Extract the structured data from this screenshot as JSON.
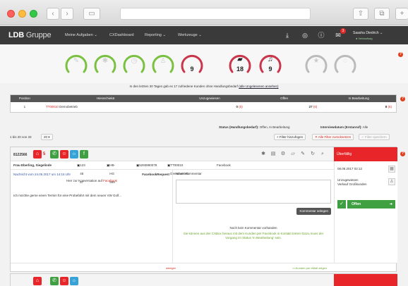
{
  "app": {
    "logo_bold": "LDB",
    "logo_rest": "Gruppe",
    "nav": [
      "Meine Aufgaben",
      "CXDashboard",
      "Reporting",
      "Werkzeuge"
    ],
    "user_name": "Saasha Diedrich",
    "user_status": "Verkaufsag",
    "notification_count": "3"
  },
  "gauges": [
    {
      "icon": "wrench-icon",
      "value": "",
      "color": "#7ac142"
    },
    {
      "icon": "star-icon",
      "value": "",
      "color": "#7ac142"
    },
    {
      "icon": "clock-icon",
      "value": "",
      "color": "#7ac142"
    },
    {
      "icon": "person-icon",
      "value": "",
      "color": "#7ac142"
    },
    {
      "icon": "",
      "value": "9",
      "color": "#c9354b"
    },
    {
      "icon": "folder-icon",
      "value": "18",
      "color": "#c9354b"
    },
    {
      "icon": "bell-icon",
      "value": "9",
      "color": "#c9354b"
    },
    {
      "icon": "star-icon",
      "value": "",
      "color": "#bbbbbb"
    },
    {
      "icon": "",
      "value": "",
      "color": "#bbbbbb"
    }
  ],
  "notice": {
    "text": "In den letzten 30 Tagen gab es 17 zufriedene Kunden ohne Handlungsbedarf",
    "link": "(alle Ungelesenen ansehen)"
  },
  "summary": {
    "headers": [
      "Position",
      "Hierarchiekä",
      "Unzugewiesen",
      "Offen",
      "In Bearbeitung"
    ],
    "rows": [
      {
        "pos": "1",
        "code": "TT00010",
        "name": "Demobetrieb",
        "unassigned": "0",
        "unassigned_red": "(0)",
        "open": "27",
        "open_red": "(0)",
        "in_progress": "8",
        "in_progress_red": "(6)"
      }
    ]
  },
  "filter": {
    "status_label": "Status (Handlungsbedarf):",
    "status_value": "Offen, In Bearbeitung",
    "date_label": "Interviewdatum (Erstanruf):",
    "date_value": "Alle",
    "count": "1 bis 20 von 33",
    "per_page": "20",
    "add_filter": "+ Filter hinzufügen",
    "reset_filter": "✕ Alle Filter zurücksetzen",
    "save_filter": "✓ Filter speichern"
  },
  "card": {
    "id": "8122566",
    "badge": "5",
    "status": "Überfällig",
    "customer": "Frau Eberling, Siegelinde",
    "phone": "123 45 67",
    "plate": "HB-HG 555",
    "order": "5293890078",
    "dealer": "TT00010 Demobetrieb",
    "channel": "Facebook",
    "message_meta": "Nachricht vom 24.05.2017 um 14:15 Uhr",
    "message_type": "FacebookRequest",
    "message_sub_prefix": "Hier zur Konversation auf ",
    "message_sub_link": "Facebook",
    "message_body": "Ich möchte gerne einen Termin für eine Probefahrt mit dem neuen VW Golf...",
    "comment_label": "Neuer Kommentar",
    "comment_button": "Kommentar anlegen",
    "no_comment": "Noch kein Kommentar vorhanden",
    "hint": "Sie können aus der CXBox heraus mit dem Kunden per Facebook in Kontakt treten! Dazu muss der Vorgang im Status 'In Bearbeitung' sein.",
    "date": "08.06.2017 02:12",
    "unassigned": "Unzugewiesen",
    "sales": "Verkauf Großkunden",
    "status_select": "Offen",
    "less": "weniger",
    "more": "<<Kunden per eMail zeigen"
  }
}
